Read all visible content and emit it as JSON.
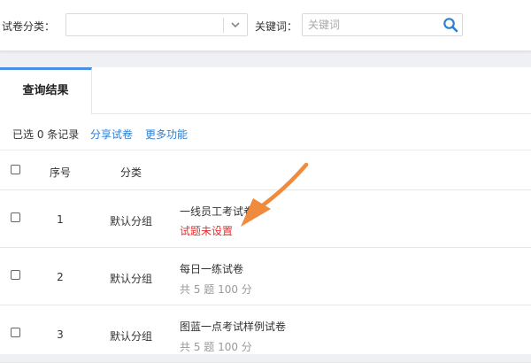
{
  "filters": {
    "category_label": "试卷分类：",
    "category_value": "",
    "keyword_label": "关键词：",
    "keyword_value": "",
    "keyword_placeholder": "关键词"
  },
  "tabs": [
    {
      "label": "查询结果",
      "active": true
    }
  ],
  "toolbar": {
    "selected_text": "已选 0 条记录",
    "share_label": "分享试卷",
    "more_label": "更多功能"
  },
  "table": {
    "headers": {
      "index": "序号",
      "category": "分类"
    },
    "rows": [
      {
        "index": "1",
        "category": "默认分组",
        "title": "一线员工考试卷",
        "sub": "试题未设置",
        "sub_type": "warn"
      },
      {
        "index": "2",
        "category": "默认分组",
        "title": "每日一练试卷",
        "sub": "共 5 题 100 分",
        "sub_type": "info"
      },
      {
        "index": "3",
        "category": "默认分组",
        "title": "图蓝一点考试样例试卷",
        "sub": "共 5 题 100 分",
        "sub_type": "info"
      }
    ]
  },
  "colors": {
    "accent": "#4a90e2",
    "link": "#2f7fd1",
    "warning": "#e0312d",
    "annotation_arrow": "#f08a3c"
  },
  "icons": {
    "search": "search-icon",
    "dropdown": "chevron-down-icon",
    "annotation": "arrow-annotation-icon"
  }
}
